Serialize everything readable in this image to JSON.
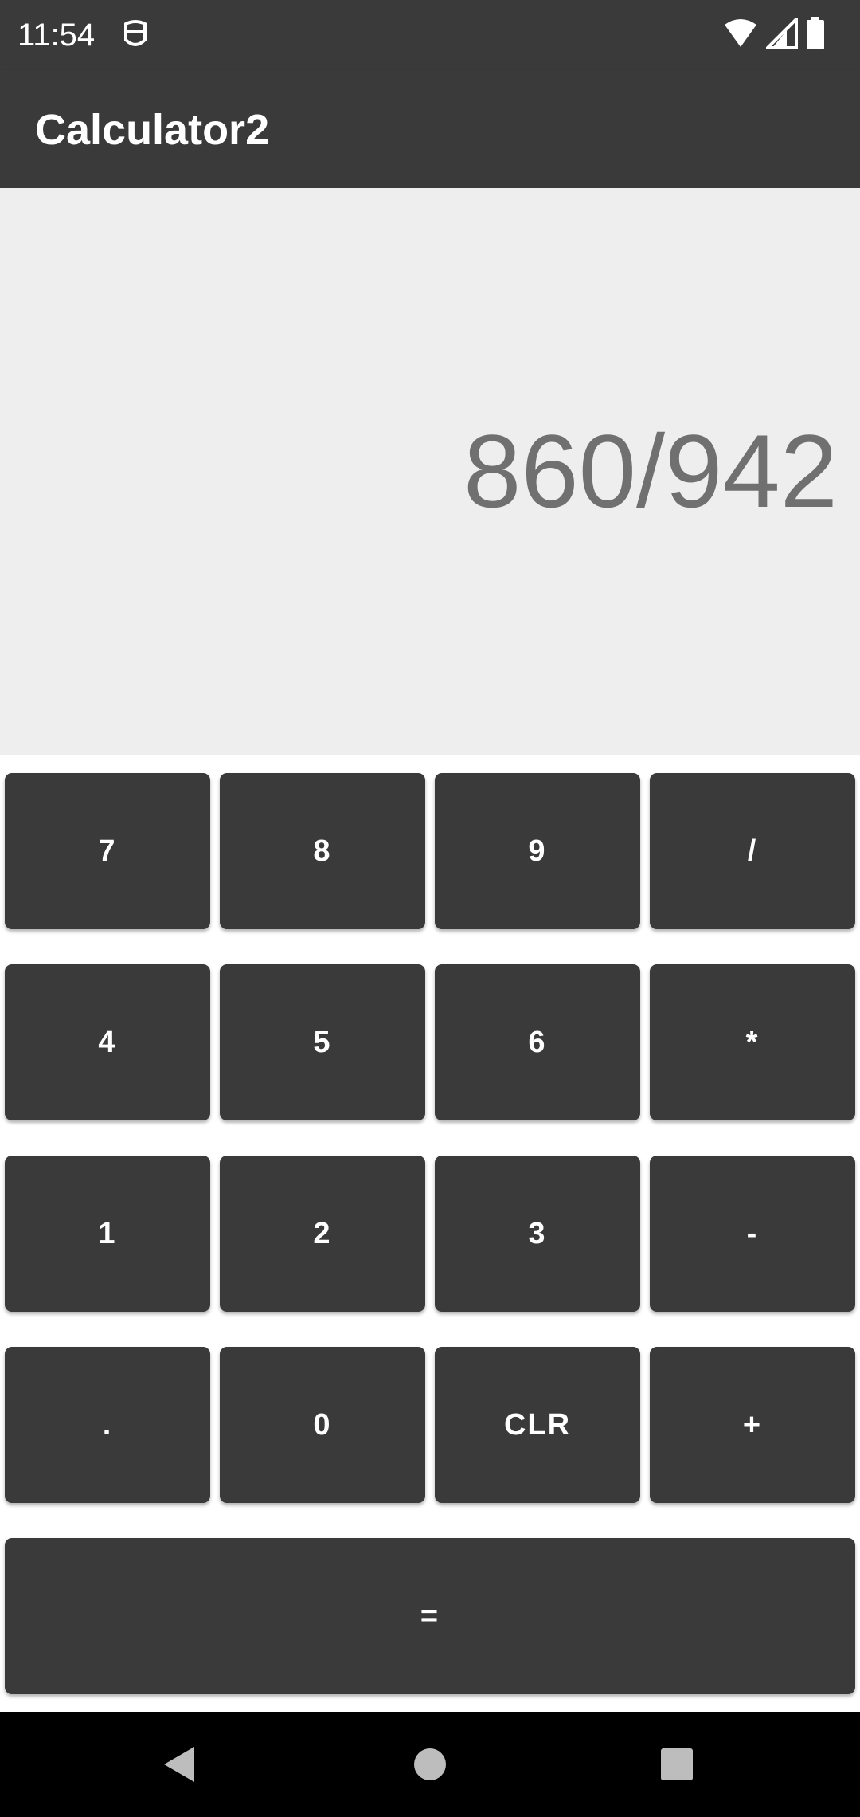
{
  "status_bar": {
    "time": "11:54",
    "notification_icon": "face-icon",
    "icons": [
      "wifi-icon",
      "signal-icon",
      "battery-icon"
    ]
  },
  "app_bar": {
    "title": "Calculator2"
  },
  "display": {
    "expression": "860/942"
  },
  "keypad": {
    "rows": [
      [
        "7",
        "8",
        "9",
        "/"
      ],
      [
        "4",
        "5",
        "6",
        "*"
      ],
      [
        "1",
        "2",
        "3",
        "-"
      ],
      [
        ".",
        "0",
        "CLR",
        "+"
      ]
    ],
    "equals_label": "="
  },
  "nav_bar": {
    "buttons": [
      "back-icon",
      "home-icon",
      "recents-icon"
    ]
  },
  "colors": {
    "bar_background": "#3a3a3a",
    "display_background": "#eeeeee",
    "display_text": "#707070",
    "key_background": "#3a3a3a"
  }
}
